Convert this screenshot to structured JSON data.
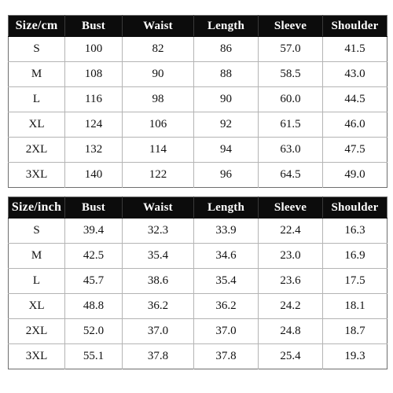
{
  "page": {
    "background_color": "#ffffff",
    "header_background_color": "#0c0c0c",
    "header_text_color": "#ffffff",
    "grid_line_color": "#b4b4b4",
    "body_text_color": "#111111"
  },
  "tables": [
    {
      "id": "table-cm",
      "unit": "cm",
      "columns": [
        "Size/cm",
        "Bust",
        "Waist",
        "Length",
        "Sleeve",
        "Shoulder"
      ],
      "rows": [
        [
          "S",
          "100",
          "82",
          "86",
          "57.0",
          "41.5"
        ],
        [
          "M",
          "108",
          "90",
          "88",
          "58.5",
          "43.0"
        ],
        [
          "L",
          "116",
          "98",
          "90",
          "60.0",
          "44.5"
        ],
        [
          "XL",
          "124",
          "106",
          "92",
          "61.5",
          "46.0"
        ],
        [
          "2XL",
          "132",
          "114",
          "94",
          "63.0",
          "47.5"
        ],
        [
          "3XL",
          "140",
          "122",
          "96",
          "64.5",
          "49.0"
        ]
      ]
    },
    {
      "id": "table-in",
      "unit": "inch",
      "columns": [
        "Size/inch",
        "Bust",
        "Waist",
        "Length",
        "Sleeve",
        "Shoulder"
      ],
      "rows": [
        [
          "S",
          "39.4",
          "32.3",
          "33.9",
          "22.4",
          "16.3"
        ],
        [
          "M",
          "42.5",
          "35.4",
          "34.6",
          "23.0",
          "16.9"
        ],
        [
          "L",
          "45.7",
          "38.6",
          "35.4",
          "23.6",
          "17.5"
        ],
        [
          "XL",
          "48.8",
          "36.2",
          "36.2",
          "24.2",
          "18.1"
        ],
        [
          "2XL",
          "52.0",
          "37.0",
          "37.0",
          "24.8",
          "18.7"
        ],
        [
          "3XL",
          "55.1",
          "37.8",
          "37.8",
          "25.4",
          "19.3"
        ]
      ]
    }
  ]
}
